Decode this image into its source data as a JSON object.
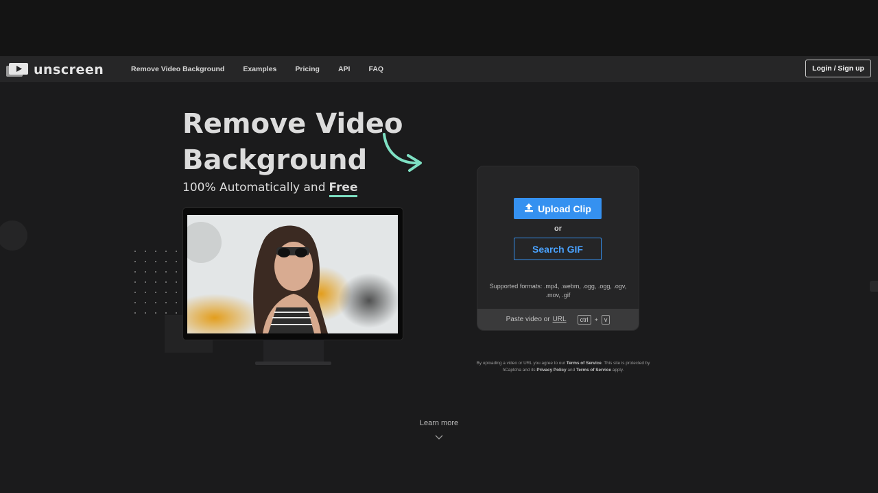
{
  "brand": {
    "name": "unscreen"
  },
  "nav": {
    "links": [
      "Remove Video Background",
      "Examples",
      "Pricing",
      "API",
      "FAQ"
    ],
    "login_label": "Login / Sign up"
  },
  "hero": {
    "title_line1": "Remove Video",
    "title_line2": "Background",
    "subtitle": "100% Automatically and",
    "subtitle_highlight": "Free"
  },
  "upload": {
    "upload_label": "Upload Clip",
    "or_label": "or",
    "gif_label": "Search GIF",
    "formats": "Supported formats: .mp4, .webm, .ogg, .ogg, .ogv, .mov, .gif",
    "paste_text": "Paste video or",
    "paste_url": "URL",
    "key_ctrl": "ctrl",
    "key_plus": "+",
    "key_v": "v"
  },
  "legal": {
    "p1": "By uploading a video or URL you agree to our",
    "tos": "Terms of Service",
    "p2": ". This site is protected by hCaptcha and its",
    "privacy": "Privacy Policy",
    "p3": "and",
    "tos2": "Terms of Service",
    "p4": "apply."
  },
  "footer": {
    "learn_more": "Learn more"
  },
  "colors": {
    "accent": "#3591f0",
    "highlight": "#7ee0c3",
    "background": "#1b1b1c",
    "nav": "#262627"
  },
  "icons": [
    "logo-play-icon",
    "upload-icon",
    "curved-arrow-icon",
    "chevron-down-icon"
  ]
}
